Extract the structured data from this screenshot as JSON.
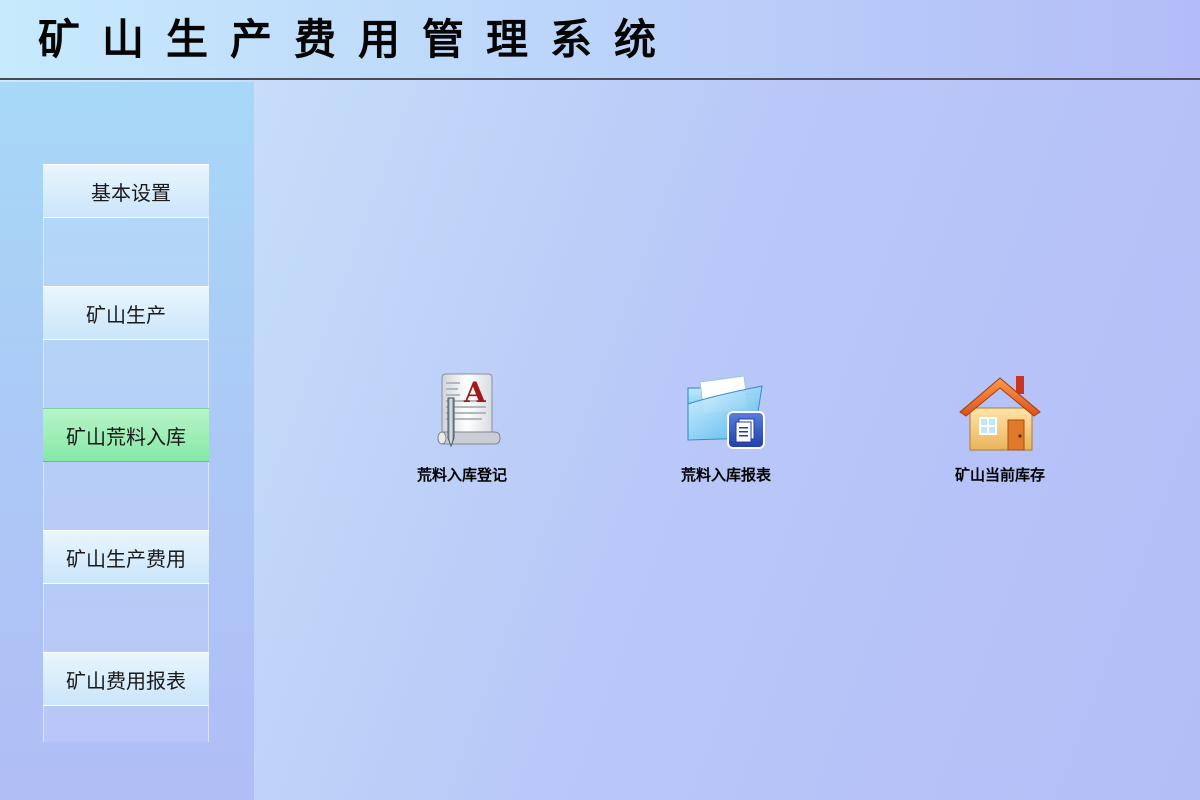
{
  "header": {
    "title": "矿山生产费用管理系统"
  },
  "sidebar": {
    "items": [
      {
        "label": "基本设置",
        "active": false
      },
      {
        "label": "矿山生产",
        "active": false
      },
      {
        "label": "矿山荒料入库",
        "active": true
      },
      {
        "label": "矿山生产费用",
        "active": false
      },
      {
        "label": "矿山费用报表",
        "active": false
      }
    ]
  },
  "main": {
    "tiles": [
      {
        "label": "荒料入库登记",
        "icon": "document-edit-icon"
      },
      {
        "label": "荒料入库报表",
        "icon": "folder-report-icon"
      },
      {
        "label": "矿山当前库存",
        "icon": "house-icon"
      }
    ]
  },
  "colors": {
    "active_item": "#86e8a6",
    "header_border": "#4a4a55"
  }
}
